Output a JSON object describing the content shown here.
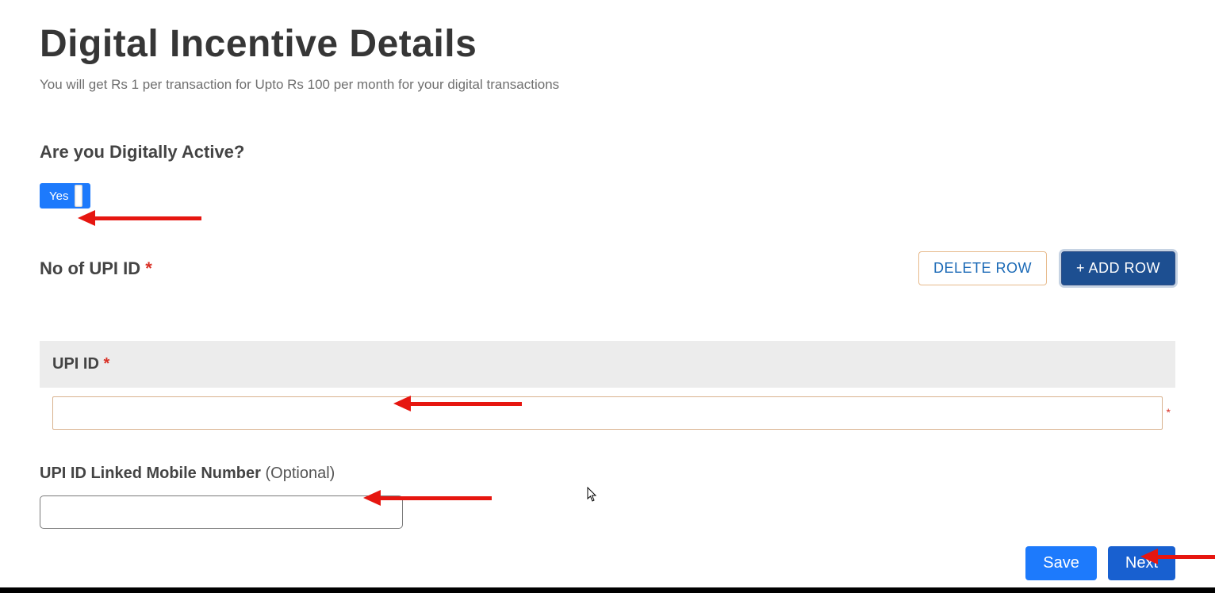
{
  "title": "Digital Incentive Details",
  "subtitle": "You will get Rs 1 per transaction for Upto Rs 100 per month for your digital transactions",
  "question_active": "Are you Digitally Active?",
  "toggle_yes": "Yes",
  "no_upi_label": "No of UPI ID",
  "delete_row": "DELETE ROW",
  "add_row": "+ ADD ROW",
  "upi_id_label": "UPI ID",
  "upi_id_value": "",
  "mobile_label": "UPI ID Linked Mobile Number",
  "mobile_optional": " (Optional)",
  "mobile_value": "",
  "save": "Save",
  "next": "Next",
  "required_mark": "*"
}
